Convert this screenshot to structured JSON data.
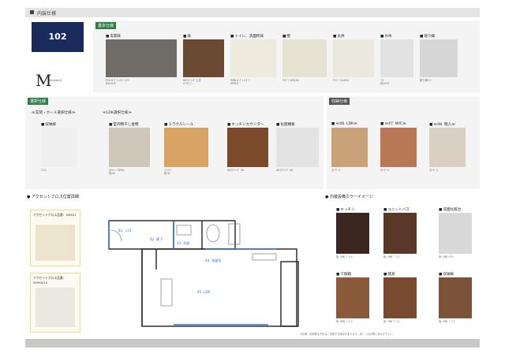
{
  "header": {
    "title": "内装仕様"
  },
  "room": {
    "number": "102"
  },
  "logo": {
    "letter": "M",
    "sub": "Standard"
  },
  "basic": {
    "title": "基本仕様",
    "items": [
      {
        "label": "玄関床",
        "color": "#6f6c68",
        "cap1": "P/S-M ｸﾞﾚｲﾝｽﾄｰﾝﾀｲﾙ",
        "cap2": "BACH-B"
      },
      {
        "label": "床",
        "color": "#6a4a33",
        "cap1": "AKﾌﾛｰﾘﾝｸﾞ工法",
        "cap2": "ｵｰｸﾁｪﾘｰ"
      },
      {
        "label": "トイレ、洗面所床",
        "color": "#eeeadd",
        "cap1": "SMR-S ｸﾞﾚｲﾝｸﾞｲ",
        "cap2": "SMR-S"
      },
      {
        "label": "壁",
        "color": "#e6e2d2",
        "cap1": "ｻﾝｹﾞﾂ SM03A",
        "cap2": ""
      },
      {
        "label": "天井",
        "color": "#ebe8dd",
        "cap1": "ｻﾝｹﾞﾂ SA024",
        "cap2": ""
      },
      {
        "label": "巾木",
        "color": "#e2e2e2",
        "cap1": "ｿﾌﾄ",
        "cap2": "色:M15"
      },
      {
        "label": "廻り縁",
        "color": "#d6d6d6",
        "cap1": "廻り縁ｺｰﾅｰ",
        "cap2": ""
      }
    ]
  },
  "optional": {
    "title": "選択仕様",
    "group1": "≪玄関・ホール選択仕様≫",
    "group2": "≪LDK選択仕様≫",
    "items": [
      {
        "label": "収納扉",
        "color": "#efefef",
        "cap1": "ｱｲｴﾙ",
        "cap2": ""
      },
      {
        "label": "室内物干し金物",
        "color": "#cec6b9",
        "cap1": "ﾎｽｸﾘｰﾝ SPKA",
        "cap2": "色:W"
      },
      {
        "label": "ミラクルレール",
        "color": "#d8a463",
        "cap1": "ﾌﾚﾝﾃｼｰ",
        "cap2": "色:W"
      },
      {
        "label": "キッチンカウンター",
        "color": "#7a4a2a",
        "cap1": "AKﾌﾛｰﾘﾝｸﾞ SK",
        "cap2": ""
      },
      {
        "label": "化粧棚板",
        "color": "#e3e3e3",
        "cap1": "AKﾌﾛｰﾘﾝｸﾞ SK",
        "cap2": ""
      }
    ]
  },
  "storage": {
    "title": "収納仕様",
    "items": [
      {
        "label": "≪48. LDK≫",
        "color": "#c9a27a",
        "cap1": "ｸﾛｰｾﾞｯﾄ",
        "cap2": ""
      },
      {
        "label": "≪47. WIC≫",
        "color": "#b87856",
        "cap1": "ｸﾛｰｾﾞｯﾄ",
        "cap2": ""
      },
      {
        "label": "≪48. 物入≫",
        "color": "#d9cfc2",
        "cap1": "ｸﾛｰｾﾞｯﾄ",
        "cap2": ""
      }
    ]
  },
  "floorplan": {
    "title": "アクセントクロス位置詳細",
    "s1": "アクセントクロス品番：SMA51",
    "s2": "アクセントクロス品番：SHM4014",
    "rooms": [
      "41. 入口",
      "42. 廊下",
      "43. 洗面",
      "44. 洗面所",
      "45. LDK"
    ]
  },
  "colorimage": {
    "title": "内装設備カラーイメージ",
    "items": [
      {
        "label": "キッチン",
        "color": "#3b2620",
        "cap": "色: SMJ ﾌﾞﾗｯｸ"
      },
      {
        "label": "ユニットバス",
        "color": "#5a3828",
        "cap": "色: SMJ ﾌﾞﾗｯｸ"
      },
      {
        "label": "洗面化粧台",
        "color": "#d8d8d8",
        "cap": "色: SMJ ﾎﾜｲﾄ"
      },
      {
        "label": "下駄箱",
        "color": "#8a5a3a",
        "cap": "色: SMJ ﾌﾞﾗｯｸ"
      },
      {
        "label": "建具",
        "color": "#7a4a30",
        "cap": "色: SMJ ﾌﾞﾗｯｸ"
      },
      {
        "label": "収納扉",
        "color": "#7c5238",
        "cap": "色: SMJ ﾌﾞﾗｯｸ"
      }
    ]
  },
  "note": "※仕様・色柄等は予告なく変更する場合があります。詳しくはお問い合わせ下さい。"
}
